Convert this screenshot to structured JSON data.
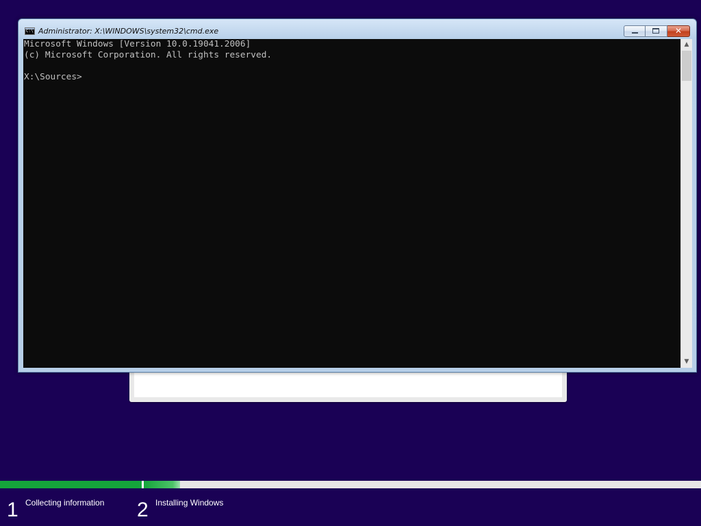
{
  "cmd_window": {
    "title": "Administrator: X:\\WINDOWS\\system32\\cmd.exe",
    "icon": "cmd-prompt-icon",
    "buttons": {
      "minimize_icon": "minimize-icon",
      "maximize_icon": "maximize-icon",
      "close_glyph": "✕"
    },
    "console_lines": [
      "Microsoft Windows [Version 10.0.19041.2006]",
      "(c) Microsoft Corporation. All rights reserved.",
      "",
      "X:\\Sources>"
    ],
    "scrollbar": {
      "up_arrow": "▲",
      "down_arrow": "▼"
    }
  },
  "setup_progress": {
    "steps": [
      {
        "number": "1",
        "label": "Collecting information",
        "progress": 1.0
      },
      {
        "number": "2",
        "label": "Installing Windows",
        "progress": 0.065
      }
    ],
    "colors": {
      "progress_fill": "#15a53b",
      "track": "#e6e6e6",
      "background": "#1a0155"
    }
  }
}
